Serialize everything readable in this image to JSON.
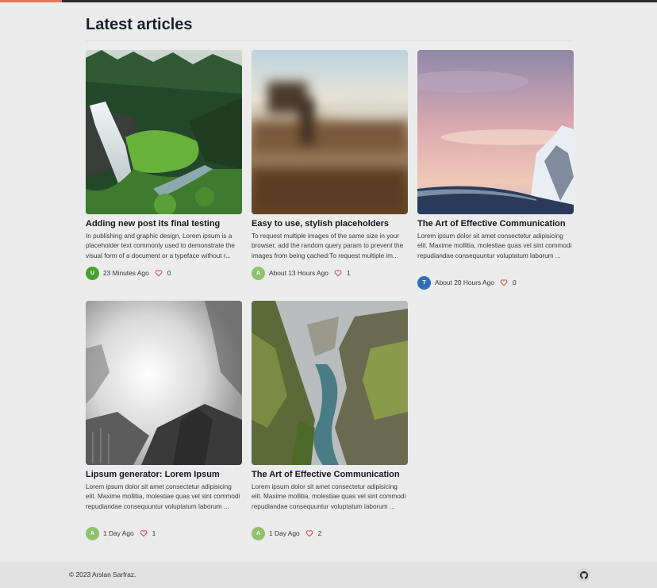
{
  "page": {
    "title": "Latest articles"
  },
  "colors": {
    "heart": "#e04c4c",
    "accent": "#e8735a"
  },
  "articles": [
    {
      "title": "Adding new post its final testing",
      "excerpt": "In publishing and graphic design, Lorem ipsum is a placeholder text commonly used to demonstrate the visual form of a document or a typeface without r...",
      "avatar": "U",
      "avatar_color": "#4aa02c",
      "time": "23 Minutes Ago",
      "likes": "0",
      "image": "waterfall forest"
    },
    {
      "title": "Easy to use, stylish placeholders",
      "excerpt": "To request multiple images of the same size in your browser, add the random query param to prevent the images from being cached:To request multiple im...",
      "avatar": "A",
      "avatar_color": "#8fc26a",
      "time": "About 13 Hours Ago",
      "likes": "1",
      "image": "blurred landscape"
    },
    {
      "title": "The Art of Effective Communication",
      "excerpt": "Lorem ipsum dolor sit amet consectetur adipisicing elit. Maxime mollitia, molestiae quas vel sint commodi repudiandae consequuntur voluptatum laborum ...",
      "avatar": "T",
      "avatar_color": "#2f6fb5",
      "time": "About 20 Hours Ago",
      "likes": "0",
      "image": "snowy mountain sunset"
    },
    {
      "title": "Lipsum generator: Lorem Ipsum",
      "excerpt": "Lorem ipsum dolor sit amet consectetur adipisicing elit. Maxime mollitia, molestiae quas vel sint commodi repudiandae consequuntur voluptatum laborum ...",
      "avatar": "A",
      "avatar_color": "#8fc26a",
      "time": "1 Day Ago",
      "likes": "1",
      "image": "misty black and white forest"
    },
    {
      "title": "The Art of Effective Communication",
      "excerpt": "Lorem ipsum dolor sit amet consectetur adipisicing elit. Maxime mollitia, molestiae quas vel sint commodi repudiandae consequuntur voluptatum laborum ...",
      "avatar": "A",
      "avatar_color": "#8fc26a",
      "time": "1 Day Ago",
      "likes": "2",
      "image": "mossy canyon river"
    }
  ],
  "footer": {
    "copyright": "© 2023 Arslan Sarfraz.",
    "icon": "github-icon"
  }
}
